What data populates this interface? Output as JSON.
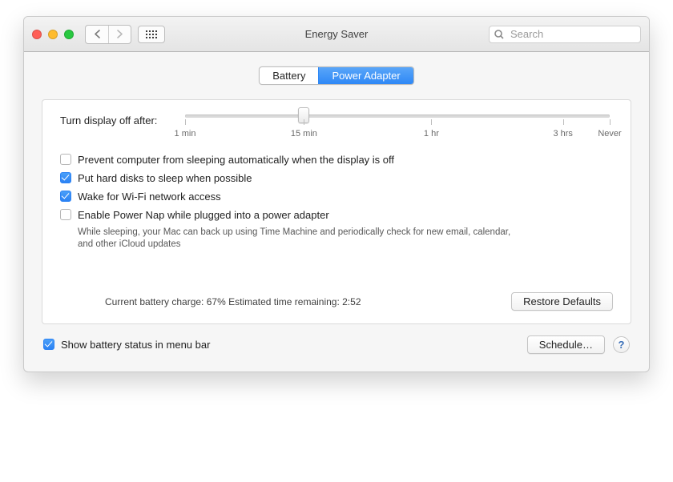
{
  "window": {
    "title": "Energy Saver",
    "search_placeholder": "Search"
  },
  "tabs": {
    "battery": "Battery",
    "power_adapter": "Power Adapter",
    "active": "power_adapter"
  },
  "slider": {
    "label": "Turn display off after:",
    "value_percent": 28,
    "ticks": {
      "t0": "1 min",
      "t1": "15 min",
      "t2": "1 hr",
      "t3": "3 hrs",
      "t4": "Never"
    }
  },
  "options": {
    "prevent_sleep": {
      "checked": false,
      "label": "Prevent computer from sleeping automatically when the display is off"
    },
    "hard_disks": {
      "checked": true,
      "label": "Put hard disks to sleep when possible"
    },
    "wake_wifi": {
      "checked": true,
      "label": "Wake for Wi-Fi network access"
    },
    "power_nap": {
      "checked": false,
      "label": "Enable Power Nap while plugged into a power adapter",
      "desc": "While sleeping, your Mac can back up using Time Machine and periodically check for new email, calendar, and other iCloud updates"
    }
  },
  "status": {
    "text": "Current battery charge: 67%   Estimated time remaining: 2:52"
  },
  "buttons": {
    "restore_defaults": "Restore Defaults",
    "schedule": "Schedule…"
  },
  "footer": {
    "show_battery": {
      "checked": true,
      "label": "Show battery status in menu bar"
    },
    "help": "?"
  }
}
